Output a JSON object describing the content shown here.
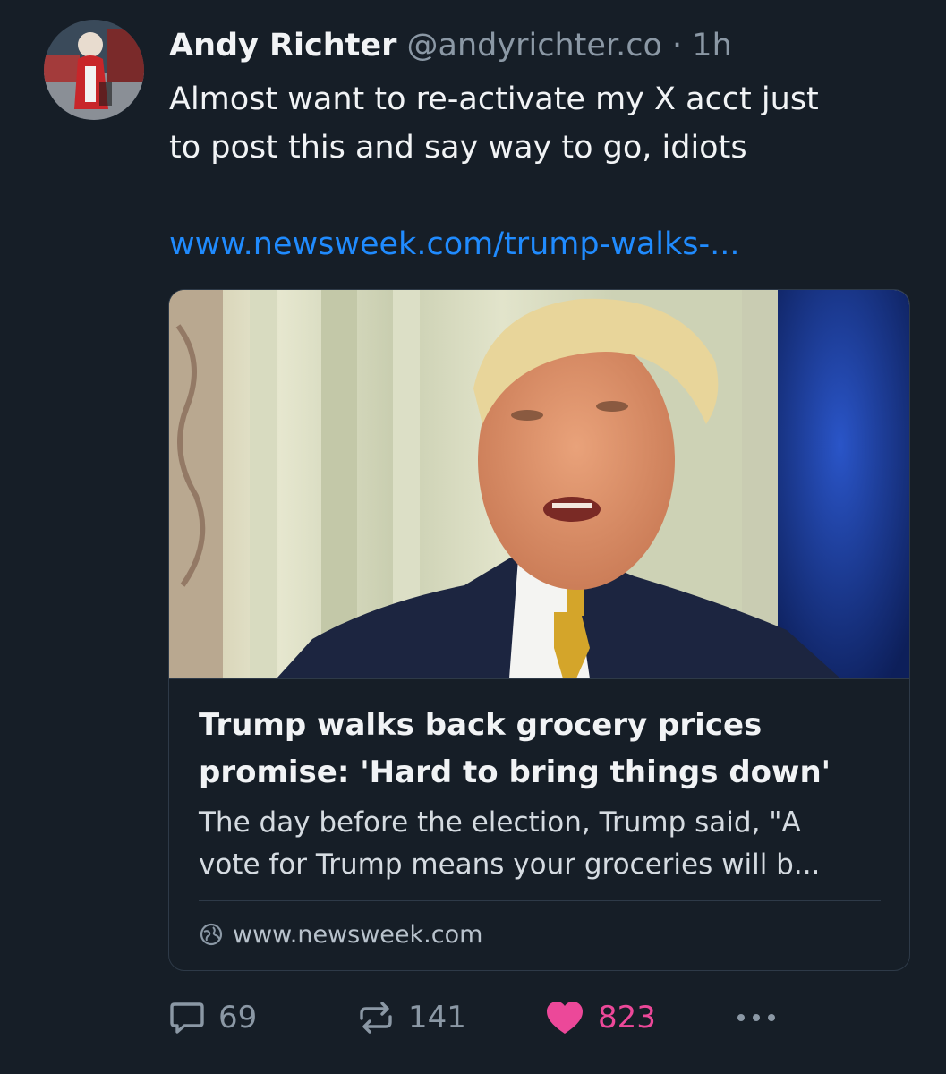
{
  "post": {
    "author_name": "Andy Richter",
    "handle": "@andyrichter.co",
    "separator": "·",
    "time": "1h",
    "text_lines": [
      "Almost want to re-activate my X acct just",
      "to post this and say way to go, idiots"
    ],
    "link_text": "www.newsweek.com/trump-walks-..."
  },
  "card": {
    "title_lines": [
      "Trump walks back grocery prices",
      "promise: 'Hard to bring things down'"
    ],
    "description_lines": [
      "The day before the election, Trump said, \"A",
      "vote for Trump means your groceries will b..."
    ],
    "domain": "www.newsweek.com",
    "globe_icon": "globe-icon"
  },
  "actions": {
    "reply_count": "69",
    "repost_count": "141",
    "like_count": "823",
    "reply_icon": "speech-bubble-icon",
    "repost_icon": "repost-arrows-icon",
    "like_icon": "heart-icon",
    "more_icon": "ellipsis-icon"
  },
  "colors": {
    "background": "#161e27",
    "link": "#208bfe",
    "like": "#ec4899",
    "muted": "#8b98a5"
  }
}
